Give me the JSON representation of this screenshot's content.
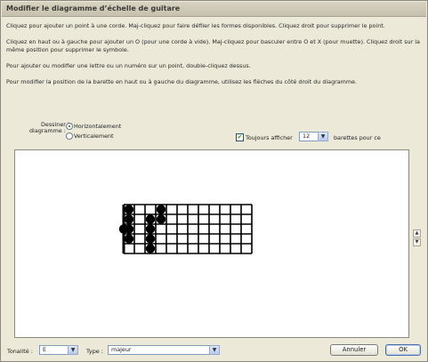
{
  "dialog": {
    "title": "Modifier le diagramme d’échelle de guitare"
  },
  "instructions": [
    "Cliquez pour ajouter un point à une corde. Maj-cliquez pour faire défiler les formes disponibles. Cliquez droit pour supprimer le point.",
    "Cliquez en haut ou à gauche pour ajouter un O (pour une corde à vide). Maj-cliquez pour basculer entre O et X (pour muette). Cliquez droit sur la même position pour supprimer le symbole.",
    "Pour ajouter ou modifier une lettre ou un numéro sur un point, double-cliquez dessus.",
    "Pour modifier la position de la barette en haut ou à gauche du diagramme, utilisez les flèches du côté droit du diagramme."
  ],
  "orientation": {
    "label_line1": "Dessiner le",
    "label_line2": "diagramme :",
    "options": [
      "Horizontalement",
      "Verticalement"
    ],
    "selected": "Horizontalement"
  },
  "frets_display": {
    "checkbox_label": "Toujours afficher",
    "checked": true,
    "value": "12",
    "suffix": "barettes pour ce"
  },
  "diagram": {
    "strings": 6,
    "frets": 12,
    "orientation": "horizontal",
    "dots": [
      {
        "string": 1,
        "fret": 1
      },
      {
        "string": 1,
        "fret": 4
      },
      {
        "string": 2,
        "fret": 1
      },
      {
        "string": 2,
        "fret": 3
      },
      {
        "string": 2,
        "fret": 4
      },
      {
        "string": 3,
        "fret": 0
      },
      {
        "string": 3,
        "fret": 1
      },
      {
        "string": 3,
        "fret": 3
      },
      {
        "string": 4,
        "fret": 1
      },
      {
        "string": 4,
        "fret": 3
      },
      {
        "string": 5,
        "fret": 3
      }
    ],
    "dot_color": "#000000"
  },
  "bottom": {
    "key_label": "Tonalité :",
    "key_value": "E",
    "type_label": "Type :",
    "type_value": "majeur",
    "cancel_label": "Annuler",
    "ok_label": "OK"
  }
}
